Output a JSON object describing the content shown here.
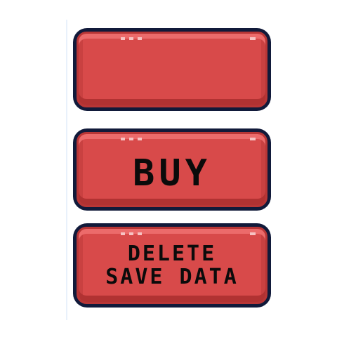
{
  "buttons": {
    "empty": {
      "label": ""
    },
    "buy": {
      "label": "BUY"
    },
    "delete": {
      "line1": "DELETE",
      "line2": "SAVE DATA"
    }
  },
  "colors": {
    "button_fill": "#d84a4a",
    "button_outline": "#111a3a",
    "text": "#0b0b0b",
    "background": "#ffffff"
  }
}
